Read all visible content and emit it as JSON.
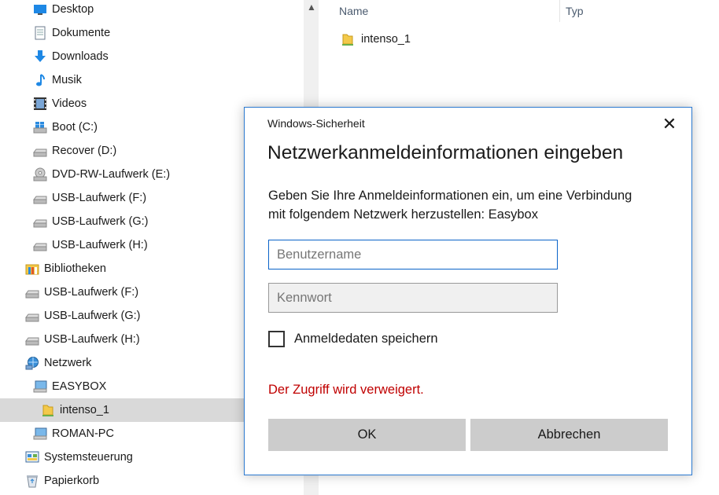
{
  "navigation": {
    "items": [
      {
        "label": "Desktop",
        "icon": "desktop-icon"
      },
      {
        "label": "Dokumente",
        "icon": "documents-icon"
      },
      {
        "label": "Downloads",
        "icon": "downloads-icon"
      },
      {
        "label": "Musik",
        "icon": "music-icon"
      },
      {
        "label": "Videos",
        "icon": "videos-icon"
      },
      {
        "label": "Boot (C:)",
        "icon": "windows-drive-icon"
      },
      {
        "label": "Recover (D:)",
        "icon": "drive-icon"
      },
      {
        "label": "DVD-RW-Laufwerk (E:)",
        "icon": "dvd-drive-icon"
      },
      {
        "label": "USB-Laufwerk (F:)",
        "icon": "usb-drive-icon"
      },
      {
        "label": "USB-Laufwerk (G:)",
        "icon": "usb-drive-icon"
      },
      {
        "label": "USB-Laufwerk (H:)",
        "icon": "usb-drive-icon"
      },
      {
        "label": "Bibliotheken",
        "icon": "libraries-icon"
      },
      {
        "label": "USB-Laufwerk (F:)",
        "icon": "usb-drive-icon"
      },
      {
        "label": "USB-Laufwerk (G:)",
        "icon": "usb-drive-icon"
      },
      {
        "label": "USB-Laufwerk (H:)",
        "icon": "usb-drive-icon"
      },
      {
        "label": "Netzwerk",
        "icon": "network-icon"
      },
      {
        "label": "EASYBOX",
        "icon": "computer-icon"
      },
      {
        "label": "intenso_1",
        "icon": "shared-folder-icon",
        "selected": true
      },
      {
        "label": "ROMAN-PC",
        "icon": "computer-icon"
      },
      {
        "label": "Systemsteuerung",
        "icon": "control-panel-icon"
      },
      {
        "label": "Papierkorb",
        "icon": "recycle-bin-icon"
      }
    ]
  },
  "file_list": {
    "columns": {
      "name": "Name",
      "type": "Typ"
    },
    "rows": [
      {
        "name": "intenso_1",
        "icon": "shared-folder-icon"
      }
    ]
  },
  "dialog": {
    "app_title": "Windows-Sicherheit",
    "heading": "Netzwerkanmeldeinformationen eingeben",
    "message_line1": "Geben Sie Ihre Anmeldeinformationen ein, um eine Verbindung",
    "message_line2": "mit folgendem Netzwerk herzustellen: Easybox",
    "username_placeholder": "Benutzername",
    "password_placeholder": "Kennwort",
    "remember_label": "Anmeldedaten speichern",
    "remember_checked": false,
    "error": "Der Zugriff wird verweigert.",
    "ok_label": "OK",
    "cancel_label": "Abbrechen",
    "close_glyph": "✕"
  },
  "colors": {
    "accent": "#2b79d0",
    "error": "#c00000",
    "selection": "#d9d9d9"
  }
}
